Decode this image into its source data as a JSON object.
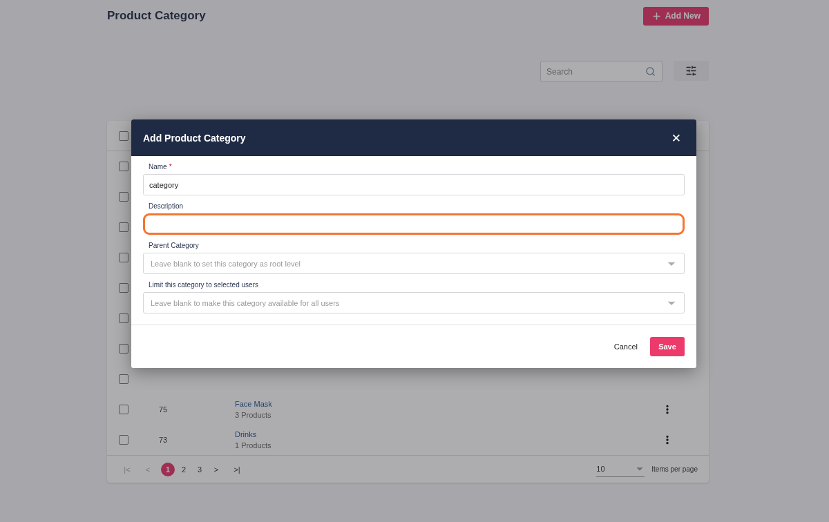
{
  "page": {
    "title": "Product Category",
    "add_button": "Add New",
    "search": {
      "placeholder": "Search"
    }
  },
  "table": {
    "header": {
      "checked": false
    },
    "rows": [
      {
        "checked": false
      },
      {
        "checked": false
      },
      {
        "checked": false
      },
      {
        "checked": false
      },
      {
        "checked": false
      },
      {
        "checked": false
      },
      {
        "checked": false
      },
      {
        "checked": false
      },
      {
        "checked": false,
        "id": "75",
        "name": "Face Mask",
        "count": "3 Products"
      },
      {
        "checked": false,
        "id": "73",
        "name": "Drinks",
        "count": "1 Products"
      }
    ],
    "pagination": {
      "first": "|<",
      "prev": "<",
      "pages": [
        {
          "label": "1",
          "selected": true
        },
        {
          "label": "2",
          "selected": false
        },
        {
          "label": "3",
          "selected": false
        }
      ],
      "next": ">",
      "last": ">|",
      "page_size": "10",
      "page_size_label": "Items per page"
    }
  },
  "dialog": {
    "title": "Add Product Category",
    "close": "✕",
    "fields": [
      {
        "kind": "text",
        "label": "Name",
        "required_mark": "*",
        "value": "category",
        "highlighted": false
      },
      {
        "kind": "text",
        "label": "Description",
        "highlighted": true
      },
      {
        "kind": "select",
        "label": "Parent Category",
        "placeholder": "Leave blank to set this category as root level",
        "highlighted": false
      },
      {
        "kind": "select",
        "label": "Limit this category to selected users",
        "placeholder": "Leave blank to make this category available for all users",
        "highlighted": false
      }
    ],
    "cancel": "Cancel",
    "save": "Save"
  }
}
